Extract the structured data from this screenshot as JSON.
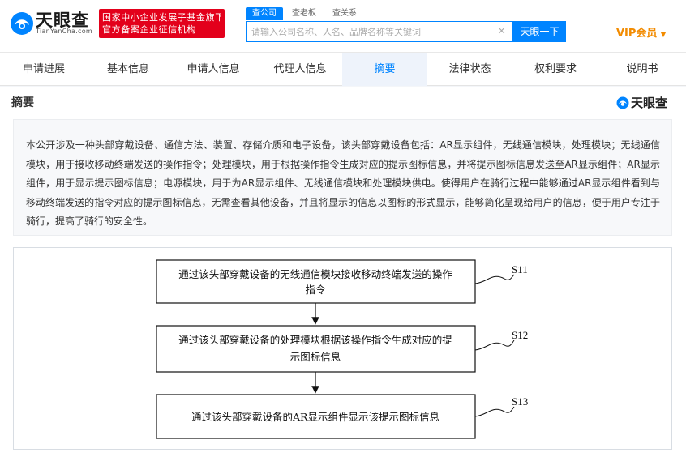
{
  "header": {
    "logo_text": "天眼查",
    "logo_sub": "TianYanCha.com",
    "badge_line1": "国家中小企业发展子基金旗下",
    "badge_line2": "官方备案企业征信机构",
    "search_tabs": [
      "查公司",
      "查老板",
      "查关系"
    ],
    "search_placeholder": "请输入公司名称、人名、品牌名称等关键词",
    "clear_glyph": "×",
    "search_button": "天眼一下",
    "vip_label": "VIP会员",
    "vip_caret": "▼"
  },
  "tabs": [
    "申请进展",
    "基本信息",
    "申请人信息",
    "代理人信息",
    "摘要",
    "法律状态",
    "权利要求",
    "说明书"
  ],
  "active_tab": "摘要",
  "section": {
    "title": "摘要",
    "brand": "天眼查"
  },
  "abstract": "本公开涉及一种头部穿戴设备、通信方法、装置、存储介质和电子设备，该头部穿戴设备包括：AR显示组件，无线通信模块，处理模块；无线通信模块，用于接收移动终端发送的操作指令；处理模块，用于根据操作指令生成对应的提示图标信息，并将提示图标信息发送至AR显示组件；AR显示组件，用于显示提示图标信息；电源模块，用于为AR显示组件、无线通信模块和处理模块供电。使得用户在骑行过程中能够通过AR显示组件看到与移动终端发送的指令对应的提示图标信息，无需查看其他设备，并且将显示的信息以图标的形式显示，能够简化呈现给用户的信息，便于用户专注于骑行，提高了骑行的安全性。",
  "flowchart": {
    "steps": [
      {
        "label": "S11",
        "line1": "通过该头部穿戴设备的无线通信模块接收移动终端发送的操作",
        "line2": "指令"
      },
      {
        "label": "S12",
        "line1": "通过该头部穿戴设备的处理模块根据该操作指令生成对应的提",
        "line2": "示图标信息"
      },
      {
        "label": "S13",
        "line1": "通过该头部穿戴设备的AR显示组件显示该提示图标信息",
        "line2": ""
      }
    ]
  },
  "colors": {
    "brand_blue": "#0084ff",
    "badge_red": "#e3001b",
    "vip_orange": "#f28b00"
  }
}
